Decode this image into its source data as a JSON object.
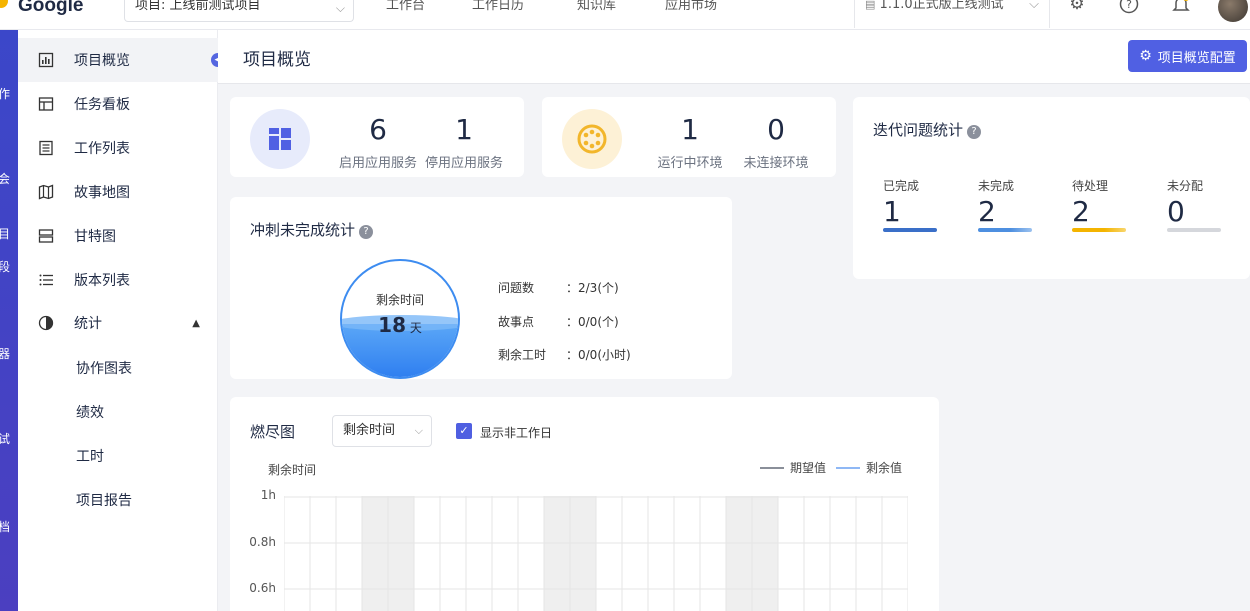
{
  "topbar": {
    "brand": "Google",
    "project_select": "项目: 上线前测试项目",
    "nav": [
      "工作台",
      "工作日历",
      "知识库",
      "应用市场"
    ],
    "version_select": "1.1.0正式版上线测试"
  },
  "rail": {
    "chars": [
      "作",
      "会",
      "目",
      "段",
      "器",
      "试",
      "档"
    ]
  },
  "sidebar": {
    "items": [
      {
        "label": "项目概览",
        "icon": "chart-icon"
      },
      {
        "label": "任务看板",
        "icon": "board-icon"
      },
      {
        "label": "工作列表",
        "icon": "list-icon"
      },
      {
        "label": "故事地图",
        "icon": "map-icon"
      },
      {
        "label": "甘特图",
        "icon": "gantt-icon"
      },
      {
        "label": "版本列表",
        "icon": "version-list-icon"
      },
      {
        "label": "统计",
        "icon": "pie-icon"
      }
    ],
    "sub_items": [
      "协作图表",
      "绩效",
      "工时",
      "项目报告"
    ]
  },
  "header": {
    "title": "项目概览",
    "config_button": "项目概览配置"
  },
  "services": {
    "enabled": "6",
    "enabled_label": "启用应用服务",
    "disabled": "1",
    "disabled_label": "停用应用服务"
  },
  "environments": {
    "running": "1",
    "running_label": "运行中环境",
    "disconnected": "0",
    "disconnected_label": "未连接环境"
  },
  "iteration": {
    "title": "迭代问题统计",
    "columns": [
      {
        "label": "已完成",
        "value": "1",
        "color": "#3a6fc8"
      },
      {
        "label": "未完成",
        "value": "2",
        "color": "#4d8fe0"
      },
      {
        "label": "待处理",
        "value": "2",
        "color": "#f4b400"
      },
      {
        "label": "未分配",
        "value": "0",
        "color": "#d5d7dc"
      }
    ]
  },
  "sprint": {
    "title": "冲刺未完成统计",
    "ring_label": "剩余时间",
    "ring_value": "18",
    "ring_unit": "天",
    "ring_fill": 0.46,
    "metrics": [
      {
        "key": "问题数",
        "value": "：2/3(个)"
      },
      {
        "key": "故事点",
        "value": "：0/0(个)"
      },
      {
        "key": "剩余工时",
        "value": "：0/0(小时)"
      }
    ]
  },
  "burndown": {
    "title": "燃尽图",
    "select_value": "剩余时间",
    "checkbox_label": "显示非工作日",
    "checkbox_checked": true,
    "y_title": "剩余时间",
    "legend": [
      {
        "name": "期望值",
        "color": "#8a8f99"
      },
      {
        "name": "剩余值",
        "color": "#8fb8f5"
      }
    ]
  },
  "chart_data": {
    "type": "line",
    "title": "燃尽图",
    "ylabel": "剩余时间",
    "y_ticks": [
      "1h",
      "0.8h",
      "0.6h"
    ],
    "ylim": [
      0.6,
      1
    ],
    "series": [
      {
        "name": "期望值",
        "values": []
      },
      {
        "name": "剩余值",
        "values": []
      }
    ],
    "columns": 24,
    "shaded_columns": [
      [
        3,
        4
      ],
      [
        10,
        11
      ],
      [
        17,
        18
      ]
    ],
    "grid": true,
    "legend_position": "top-right"
  }
}
